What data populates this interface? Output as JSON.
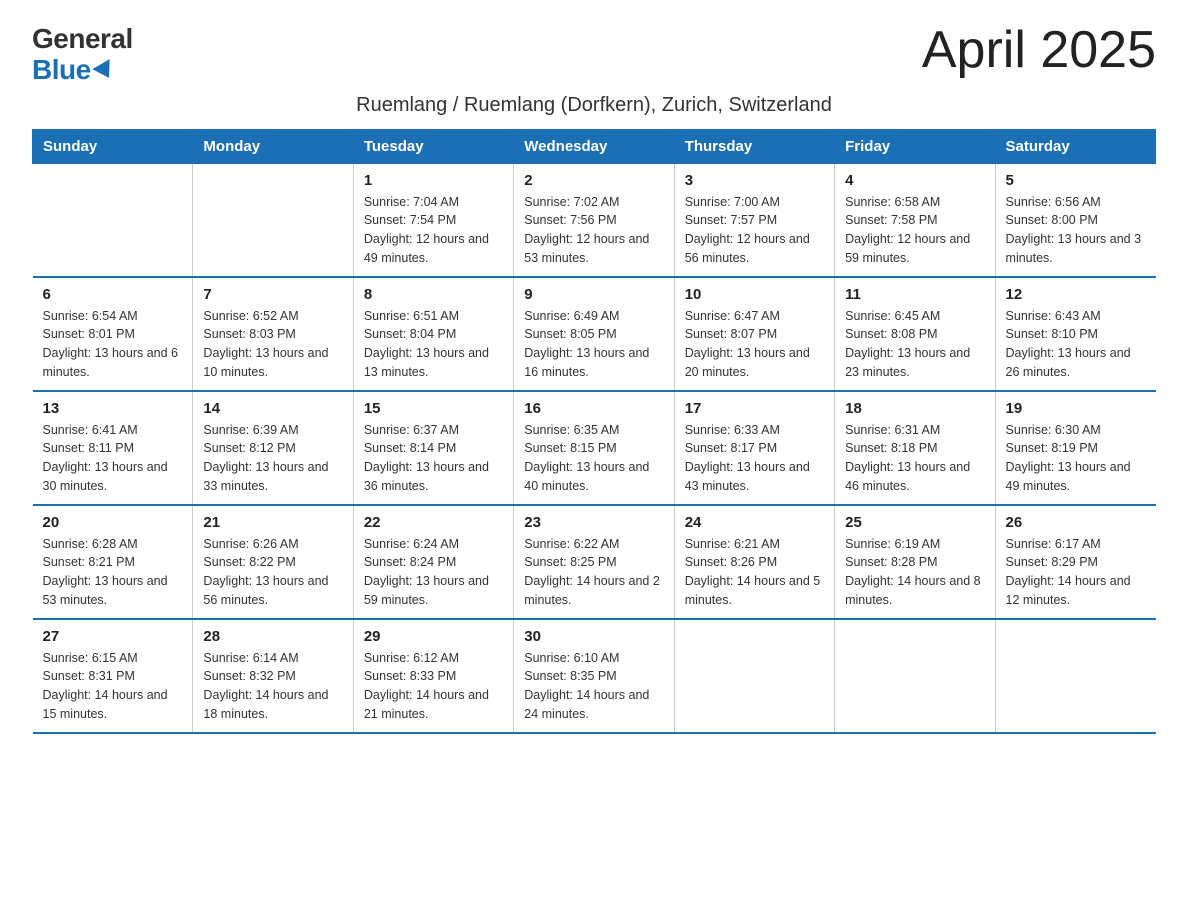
{
  "header": {
    "logo_general": "General",
    "logo_blue": "Blue",
    "month_title": "April 2025",
    "location": "Ruemlang / Ruemlang (Dorfkern), Zurich, Switzerland"
  },
  "days_of_week": [
    "Sunday",
    "Monday",
    "Tuesday",
    "Wednesday",
    "Thursday",
    "Friday",
    "Saturday"
  ],
  "weeks": [
    [
      {
        "day": "",
        "sunrise": "",
        "sunset": "",
        "daylight": ""
      },
      {
        "day": "",
        "sunrise": "",
        "sunset": "",
        "daylight": ""
      },
      {
        "day": "1",
        "sunrise": "Sunrise: 7:04 AM",
        "sunset": "Sunset: 7:54 PM",
        "daylight": "Daylight: 12 hours and 49 minutes."
      },
      {
        "day": "2",
        "sunrise": "Sunrise: 7:02 AM",
        "sunset": "Sunset: 7:56 PM",
        "daylight": "Daylight: 12 hours and 53 minutes."
      },
      {
        "day": "3",
        "sunrise": "Sunrise: 7:00 AM",
        "sunset": "Sunset: 7:57 PM",
        "daylight": "Daylight: 12 hours and 56 minutes."
      },
      {
        "day": "4",
        "sunrise": "Sunrise: 6:58 AM",
        "sunset": "Sunset: 7:58 PM",
        "daylight": "Daylight: 12 hours and 59 minutes."
      },
      {
        "day": "5",
        "sunrise": "Sunrise: 6:56 AM",
        "sunset": "Sunset: 8:00 PM",
        "daylight": "Daylight: 13 hours and 3 minutes."
      }
    ],
    [
      {
        "day": "6",
        "sunrise": "Sunrise: 6:54 AM",
        "sunset": "Sunset: 8:01 PM",
        "daylight": "Daylight: 13 hours and 6 minutes."
      },
      {
        "day": "7",
        "sunrise": "Sunrise: 6:52 AM",
        "sunset": "Sunset: 8:03 PM",
        "daylight": "Daylight: 13 hours and 10 minutes."
      },
      {
        "day": "8",
        "sunrise": "Sunrise: 6:51 AM",
        "sunset": "Sunset: 8:04 PM",
        "daylight": "Daylight: 13 hours and 13 minutes."
      },
      {
        "day": "9",
        "sunrise": "Sunrise: 6:49 AM",
        "sunset": "Sunset: 8:05 PM",
        "daylight": "Daylight: 13 hours and 16 minutes."
      },
      {
        "day": "10",
        "sunrise": "Sunrise: 6:47 AM",
        "sunset": "Sunset: 8:07 PM",
        "daylight": "Daylight: 13 hours and 20 minutes."
      },
      {
        "day": "11",
        "sunrise": "Sunrise: 6:45 AM",
        "sunset": "Sunset: 8:08 PM",
        "daylight": "Daylight: 13 hours and 23 minutes."
      },
      {
        "day": "12",
        "sunrise": "Sunrise: 6:43 AM",
        "sunset": "Sunset: 8:10 PM",
        "daylight": "Daylight: 13 hours and 26 minutes."
      }
    ],
    [
      {
        "day": "13",
        "sunrise": "Sunrise: 6:41 AM",
        "sunset": "Sunset: 8:11 PM",
        "daylight": "Daylight: 13 hours and 30 minutes."
      },
      {
        "day": "14",
        "sunrise": "Sunrise: 6:39 AM",
        "sunset": "Sunset: 8:12 PM",
        "daylight": "Daylight: 13 hours and 33 minutes."
      },
      {
        "day": "15",
        "sunrise": "Sunrise: 6:37 AM",
        "sunset": "Sunset: 8:14 PM",
        "daylight": "Daylight: 13 hours and 36 minutes."
      },
      {
        "day": "16",
        "sunrise": "Sunrise: 6:35 AM",
        "sunset": "Sunset: 8:15 PM",
        "daylight": "Daylight: 13 hours and 40 minutes."
      },
      {
        "day": "17",
        "sunrise": "Sunrise: 6:33 AM",
        "sunset": "Sunset: 8:17 PM",
        "daylight": "Daylight: 13 hours and 43 minutes."
      },
      {
        "day": "18",
        "sunrise": "Sunrise: 6:31 AM",
        "sunset": "Sunset: 8:18 PM",
        "daylight": "Daylight: 13 hours and 46 minutes."
      },
      {
        "day": "19",
        "sunrise": "Sunrise: 6:30 AM",
        "sunset": "Sunset: 8:19 PM",
        "daylight": "Daylight: 13 hours and 49 minutes."
      }
    ],
    [
      {
        "day": "20",
        "sunrise": "Sunrise: 6:28 AM",
        "sunset": "Sunset: 8:21 PM",
        "daylight": "Daylight: 13 hours and 53 minutes."
      },
      {
        "day": "21",
        "sunrise": "Sunrise: 6:26 AM",
        "sunset": "Sunset: 8:22 PM",
        "daylight": "Daylight: 13 hours and 56 minutes."
      },
      {
        "day": "22",
        "sunrise": "Sunrise: 6:24 AM",
        "sunset": "Sunset: 8:24 PM",
        "daylight": "Daylight: 13 hours and 59 minutes."
      },
      {
        "day": "23",
        "sunrise": "Sunrise: 6:22 AM",
        "sunset": "Sunset: 8:25 PM",
        "daylight": "Daylight: 14 hours and 2 minutes."
      },
      {
        "day": "24",
        "sunrise": "Sunrise: 6:21 AM",
        "sunset": "Sunset: 8:26 PM",
        "daylight": "Daylight: 14 hours and 5 minutes."
      },
      {
        "day": "25",
        "sunrise": "Sunrise: 6:19 AM",
        "sunset": "Sunset: 8:28 PM",
        "daylight": "Daylight: 14 hours and 8 minutes."
      },
      {
        "day": "26",
        "sunrise": "Sunrise: 6:17 AM",
        "sunset": "Sunset: 8:29 PM",
        "daylight": "Daylight: 14 hours and 12 minutes."
      }
    ],
    [
      {
        "day": "27",
        "sunrise": "Sunrise: 6:15 AM",
        "sunset": "Sunset: 8:31 PM",
        "daylight": "Daylight: 14 hours and 15 minutes."
      },
      {
        "day": "28",
        "sunrise": "Sunrise: 6:14 AM",
        "sunset": "Sunset: 8:32 PM",
        "daylight": "Daylight: 14 hours and 18 minutes."
      },
      {
        "day": "29",
        "sunrise": "Sunrise: 6:12 AM",
        "sunset": "Sunset: 8:33 PM",
        "daylight": "Daylight: 14 hours and 21 minutes."
      },
      {
        "day": "30",
        "sunrise": "Sunrise: 6:10 AM",
        "sunset": "Sunset: 8:35 PM",
        "daylight": "Daylight: 14 hours and 24 minutes."
      },
      {
        "day": "",
        "sunrise": "",
        "sunset": "",
        "daylight": ""
      },
      {
        "day": "",
        "sunrise": "",
        "sunset": "",
        "daylight": ""
      },
      {
        "day": "",
        "sunrise": "",
        "sunset": "",
        "daylight": ""
      }
    ]
  ]
}
